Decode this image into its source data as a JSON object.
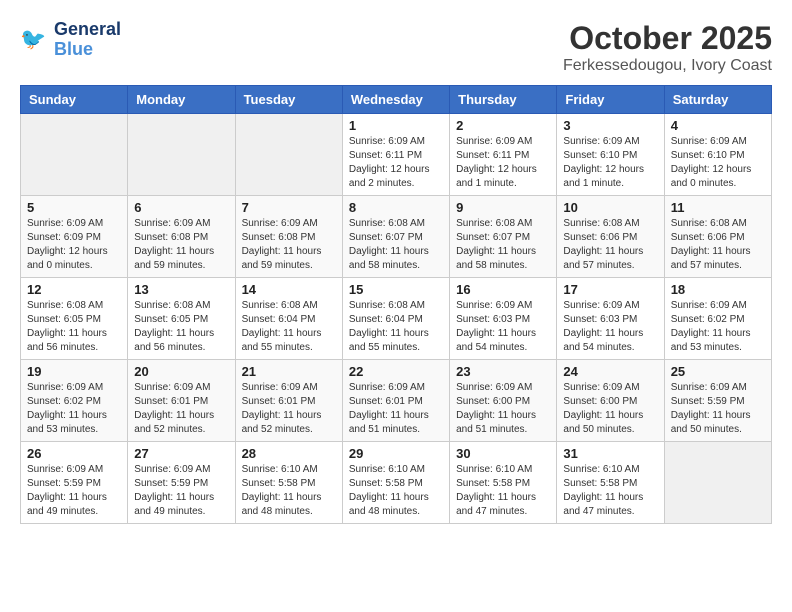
{
  "header": {
    "logo_line1": "General",
    "logo_line2": "Blue",
    "month": "October 2025",
    "location": "Ferkessedougou, Ivory Coast"
  },
  "weekdays": [
    "Sunday",
    "Monday",
    "Tuesday",
    "Wednesday",
    "Thursday",
    "Friday",
    "Saturday"
  ],
  "weeks": [
    [
      {
        "day": "",
        "sunrise": "",
        "sunset": "",
        "daylight": ""
      },
      {
        "day": "",
        "sunrise": "",
        "sunset": "",
        "daylight": ""
      },
      {
        "day": "",
        "sunrise": "",
        "sunset": "",
        "daylight": ""
      },
      {
        "day": "1",
        "sunrise": "Sunrise: 6:09 AM",
        "sunset": "Sunset: 6:11 PM",
        "daylight": "Daylight: 12 hours and 2 minutes."
      },
      {
        "day": "2",
        "sunrise": "Sunrise: 6:09 AM",
        "sunset": "Sunset: 6:11 PM",
        "daylight": "Daylight: 12 hours and 1 minute."
      },
      {
        "day": "3",
        "sunrise": "Sunrise: 6:09 AM",
        "sunset": "Sunset: 6:10 PM",
        "daylight": "Daylight: 12 hours and 1 minute."
      },
      {
        "day": "4",
        "sunrise": "Sunrise: 6:09 AM",
        "sunset": "Sunset: 6:10 PM",
        "daylight": "Daylight: 12 hours and 0 minutes."
      }
    ],
    [
      {
        "day": "5",
        "sunrise": "Sunrise: 6:09 AM",
        "sunset": "Sunset: 6:09 PM",
        "daylight": "Daylight: 12 hours and 0 minutes."
      },
      {
        "day": "6",
        "sunrise": "Sunrise: 6:09 AM",
        "sunset": "Sunset: 6:08 PM",
        "daylight": "Daylight: 11 hours and 59 minutes."
      },
      {
        "day": "7",
        "sunrise": "Sunrise: 6:09 AM",
        "sunset": "Sunset: 6:08 PM",
        "daylight": "Daylight: 11 hours and 59 minutes."
      },
      {
        "day": "8",
        "sunrise": "Sunrise: 6:08 AM",
        "sunset": "Sunset: 6:07 PM",
        "daylight": "Daylight: 11 hours and 58 minutes."
      },
      {
        "day": "9",
        "sunrise": "Sunrise: 6:08 AM",
        "sunset": "Sunset: 6:07 PM",
        "daylight": "Daylight: 11 hours and 58 minutes."
      },
      {
        "day": "10",
        "sunrise": "Sunrise: 6:08 AM",
        "sunset": "Sunset: 6:06 PM",
        "daylight": "Daylight: 11 hours and 57 minutes."
      },
      {
        "day": "11",
        "sunrise": "Sunrise: 6:08 AM",
        "sunset": "Sunset: 6:06 PM",
        "daylight": "Daylight: 11 hours and 57 minutes."
      }
    ],
    [
      {
        "day": "12",
        "sunrise": "Sunrise: 6:08 AM",
        "sunset": "Sunset: 6:05 PM",
        "daylight": "Daylight: 11 hours and 56 minutes."
      },
      {
        "day": "13",
        "sunrise": "Sunrise: 6:08 AM",
        "sunset": "Sunset: 6:05 PM",
        "daylight": "Daylight: 11 hours and 56 minutes."
      },
      {
        "day": "14",
        "sunrise": "Sunrise: 6:08 AM",
        "sunset": "Sunset: 6:04 PM",
        "daylight": "Daylight: 11 hours and 55 minutes."
      },
      {
        "day": "15",
        "sunrise": "Sunrise: 6:08 AM",
        "sunset": "Sunset: 6:04 PM",
        "daylight": "Daylight: 11 hours and 55 minutes."
      },
      {
        "day": "16",
        "sunrise": "Sunrise: 6:09 AM",
        "sunset": "Sunset: 6:03 PM",
        "daylight": "Daylight: 11 hours and 54 minutes."
      },
      {
        "day": "17",
        "sunrise": "Sunrise: 6:09 AM",
        "sunset": "Sunset: 6:03 PM",
        "daylight": "Daylight: 11 hours and 54 minutes."
      },
      {
        "day": "18",
        "sunrise": "Sunrise: 6:09 AM",
        "sunset": "Sunset: 6:02 PM",
        "daylight": "Daylight: 11 hours and 53 minutes."
      }
    ],
    [
      {
        "day": "19",
        "sunrise": "Sunrise: 6:09 AM",
        "sunset": "Sunset: 6:02 PM",
        "daylight": "Daylight: 11 hours and 53 minutes."
      },
      {
        "day": "20",
        "sunrise": "Sunrise: 6:09 AM",
        "sunset": "Sunset: 6:01 PM",
        "daylight": "Daylight: 11 hours and 52 minutes."
      },
      {
        "day": "21",
        "sunrise": "Sunrise: 6:09 AM",
        "sunset": "Sunset: 6:01 PM",
        "daylight": "Daylight: 11 hours and 52 minutes."
      },
      {
        "day": "22",
        "sunrise": "Sunrise: 6:09 AM",
        "sunset": "Sunset: 6:01 PM",
        "daylight": "Daylight: 11 hours and 51 minutes."
      },
      {
        "day": "23",
        "sunrise": "Sunrise: 6:09 AM",
        "sunset": "Sunset: 6:00 PM",
        "daylight": "Daylight: 11 hours and 51 minutes."
      },
      {
        "day": "24",
        "sunrise": "Sunrise: 6:09 AM",
        "sunset": "Sunset: 6:00 PM",
        "daylight": "Daylight: 11 hours and 50 minutes."
      },
      {
        "day": "25",
        "sunrise": "Sunrise: 6:09 AM",
        "sunset": "Sunset: 5:59 PM",
        "daylight": "Daylight: 11 hours and 50 minutes."
      }
    ],
    [
      {
        "day": "26",
        "sunrise": "Sunrise: 6:09 AM",
        "sunset": "Sunset: 5:59 PM",
        "daylight": "Daylight: 11 hours and 49 minutes."
      },
      {
        "day": "27",
        "sunrise": "Sunrise: 6:09 AM",
        "sunset": "Sunset: 5:59 PM",
        "daylight": "Daylight: 11 hours and 49 minutes."
      },
      {
        "day": "28",
        "sunrise": "Sunrise: 6:10 AM",
        "sunset": "Sunset: 5:58 PM",
        "daylight": "Daylight: 11 hours and 48 minutes."
      },
      {
        "day": "29",
        "sunrise": "Sunrise: 6:10 AM",
        "sunset": "Sunset: 5:58 PM",
        "daylight": "Daylight: 11 hours and 48 minutes."
      },
      {
        "day": "30",
        "sunrise": "Sunrise: 6:10 AM",
        "sunset": "Sunset: 5:58 PM",
        "daylight": "Daylight: 11 hours and 47 minutes."
      },
      {
        "day": "31",
        "sunrise": "Sunrise: 6:10 AM",
        "sunset": "Sunset: 5:58 PM",
        "daylight": "Daylight: 11 hours and 47 minutes."
      },
      {
        "day": "",
        "sunrise": "",
        "sunset": "",
        "daylight": ""
      }
    ]
  ]
}
